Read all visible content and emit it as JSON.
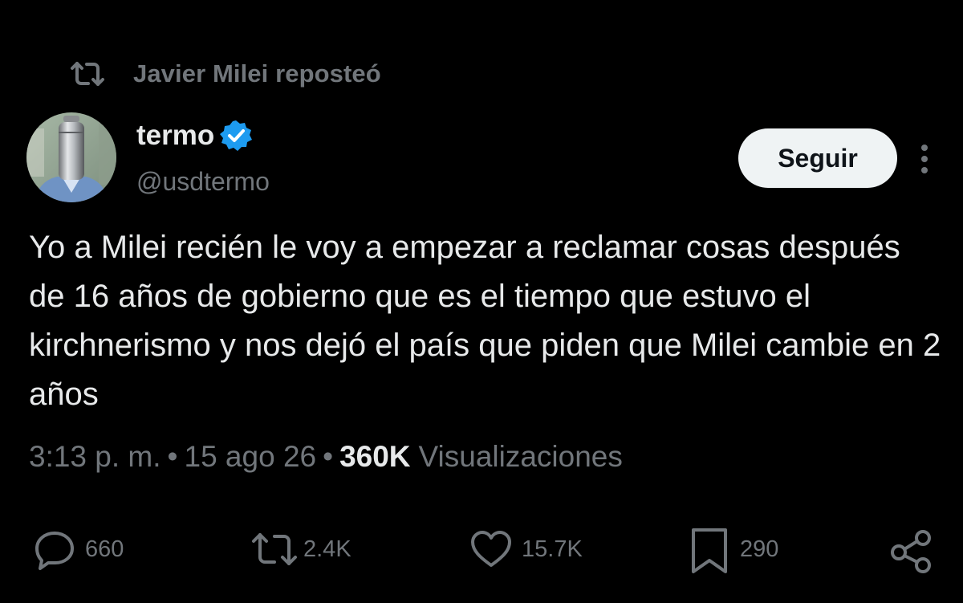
{
  "repost": {
    "label": "Javier Milei reposteó",
    "icon": "repost-icon"
  },
  "author": {
    "name": "termo",
    "handle": "@usdtermo",
    "verified_color": "#1d9bf0",
    "avatar": "thermos-avatar"
  },
  "follow_button": {
    "label": "Seguir"
  },
  "more_icon": "more-vertical-icon",
  "tweet": {
    "text": "Yo a Milei recién le voy a empezar a reclamar cosas después de 16 años de gobierno que es el tiempo que estuvo el kirchnerismo y nos dejó el país que piden que Milei cambie en 2 años"
  },
  "meta": {
    "time": "3:13 p. m.",
    "separator": "•",
    "date": "15 ago 26",
    "views_count": "360K",
    "views_label": "Visualizaciones"
  },
  "actions": {
    "replies": {
      "icon": "reply-icon",
      "count": "660"
    },
    "reposts": {
      "icon": "repost-icon",
      "count": "2.4K"
    },
    "likes": {
      "icon": "heart-icon",
      "count": "15.7K"
    },
    "bookmarks": {
      "icon": "bookmark-icon",
      "count": "290"
    },
    "share": {
      "icon": "share-icon"
    }
  },
  "colors": {
    "background": "#000000",
    "text_primary": "#e7e9ea",
    "text_secondary": "#71767b",
    "button_bg": "#eff3f4",
    "verified": "#1d9bf0"
  }
}
